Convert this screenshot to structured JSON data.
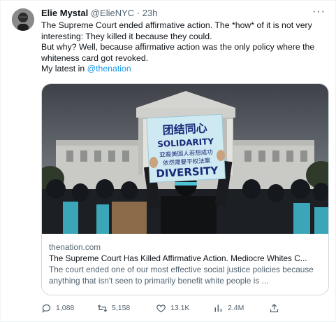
{
  "author": {
    "name": "Elie Mystal",
    "handle": "@ElieNYC",
    "separator": "·",
    "time": "23h"
  },
  "more_label": "···",
  "body": {
    "line1": "The Supreme Court ended affirmative action. The *how* of it is not very interesting: They killed it because they could.",
    "line2": "But why? Well, because affirmative action was the only policy where the whiteness card got revoked.",
    "line3_prefix": "My latest in ",
    "mention": "@thenation"
  },
  "card": {
    "domain": "thenation.com",
    "title": "The Supreme Court Has Killed Affirmative Action. Mediocre Whites C...",
    "description": "The court ended one of our most effective social justice policies because anything that isn't seen to primarily benefit white people is ...",
    "sign": {
      "line1": "团结同心",
      "line2": "SOLIDARITY",
      "line3": "亚裔美国人若想成功",
      "line4": "依然需要平权法案",
      "line5": "DIVERSITY"
    }
  },
  "actions": {
    "replies": "1,088",
    "reposts": "5,158",
    "likes": "13.1K",
    "views": "2.4M"
  },
  "colors": {
    "accent": "#1d9bf0",
    "secondary_text": "#536471",
    "border": "#cfd9de"
  }
}
